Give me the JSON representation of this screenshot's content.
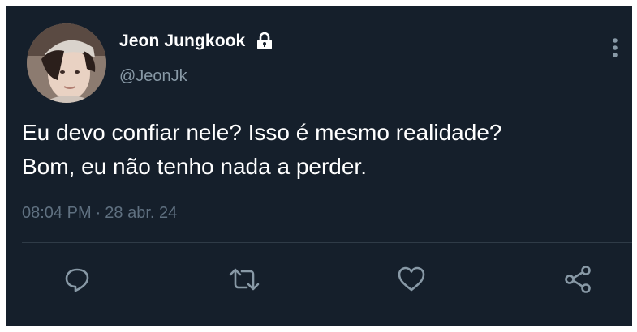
{
  "user": {
    "display_name": "Jeon Jungkook",
    "handle": "@JeonJk",
    "protected_icon": "lock-icon",
    "avatar": "profile-photo"
  },
  "tweet": {
    "text_line1": "Eu devo confiar nele? Isso é mesmo realidade?",
    "text_line2": "Bom, eu não tenho nada a perder.",
    "time": "08:04 PM",
    "separator": "·",
    "date": "28 abr. 24"
  },
  "actions": {
    "reply_icon": "reply-icon",
    "retweet_icon": "retweet-icon",
    "like_icon": "heart-icon",
    "share_icon": "share-icon",
    "more_icon": "more-vertical-icon"
  },
  "colors": {
    "background": "#151f2b",
    "primary_text": "#ffffff",
    "secondary_text": "#8899a6",
    "icon": "#8899a6",
    "divider": "#2f3b47"
  }
}
